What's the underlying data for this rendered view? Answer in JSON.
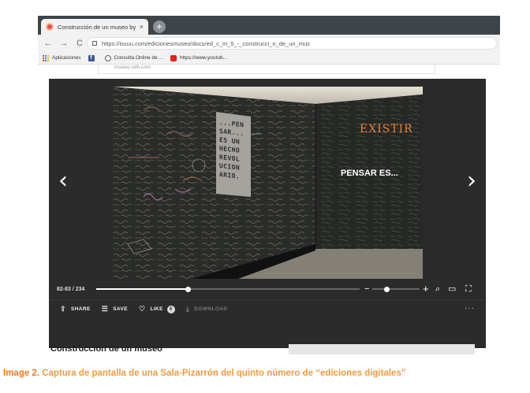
{
  "browser": {
    "tab_title": "Construcción de un museo by Ed",
    "tab_close": "×",
    "new_tab": "+",
    "url": "https://issuu.com/edicionesmuseo/docs/ed_c_m_5_-_construcci_n_de_un_mus",
    "nav": {
      "back": "←",
      "forward": "→",
      "reload": "C"
    },
    "bookmarks": [
      {
        "label": "Aplicaciones",
        "icon": "apps-grid-icon"
      },
      {
        "label": "",
        "icon": "facebook-icon"
      },
      {
        "label": "Consulta Online de ...",
        "icon": "globe-icon"
      },
      {
        "label": "https://www.youtub...",
        "icon": "youtube-icon"
      }
    ]
  },
  "page": {
    "top_card_text": "museo-sdh.com",
    "viewer": {
      "page_counter": "82-83 / 234",
      "progress_fraction": 0.35,
      "zoom_fraction": 0.3,
      "photo": {
        "plaque_text": [
          "...PEN",
          "SAR...",
          "ES UN",
          "HECHO",
          "REVOL",
          "UCION",
          "ARIO."
        ],
        "wall_text": "EXISTIR",
        "overlay_text": "PENSAR ES..."
      },
      "actions": [
        {
          "label": "SHARE",
          "icon": "share-icon"
        },
        {
          "label": "SAVE",
          "icon": "save-icon"
        },
        {
          "label": "LIKE",
          "icon": "heart-icon",
          "count": "6"
        },
        {
          "label": "DOWNLOAD",
          "icon": "download-icon"
        }
      ],
      "more_label": "···",
      "prev_glyph": "‹",
      "next_glyph": "›"
    },
    "document_title": "Construcción de un museo"
  },
  "caption": {
    "label": "Image 2.",
    "text": " Captura de pantalla de una Sala-Pizarrón del quinto número de “ediciones digitales”"
  },
  "colors": {
    "caption": "#f29a3e",
    "viewer_bg": "#2b2b2b",
    "chalkboard": "#232623",
    "chalk_orange": "#e8823a"
  }
}
